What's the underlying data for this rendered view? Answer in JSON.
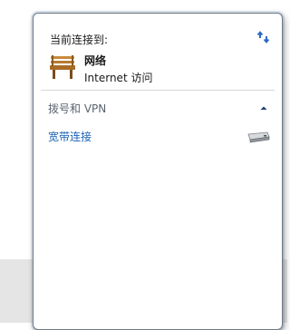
{
  "header": {
    "label": "当前连接到:"
  },
  "network": {
    "name": "网络",
    "status": "Internet 访问",
    "icon": "network-bench-icon"
  },
  "section": {
    "title": "拨号和 VPN",
    "collapse_icon": "chevron-up-icon"
  },
  "connections": [
    {
      "name": "宽带连接",
      "icon": "modem-icon"
    }
  ],
  "colors": {
    "link": "#1b62b8",
    "section_title": "#5a6470",
    "border": "#6f7a86",
    "chevron": "#1f3f6e"
  }
}
